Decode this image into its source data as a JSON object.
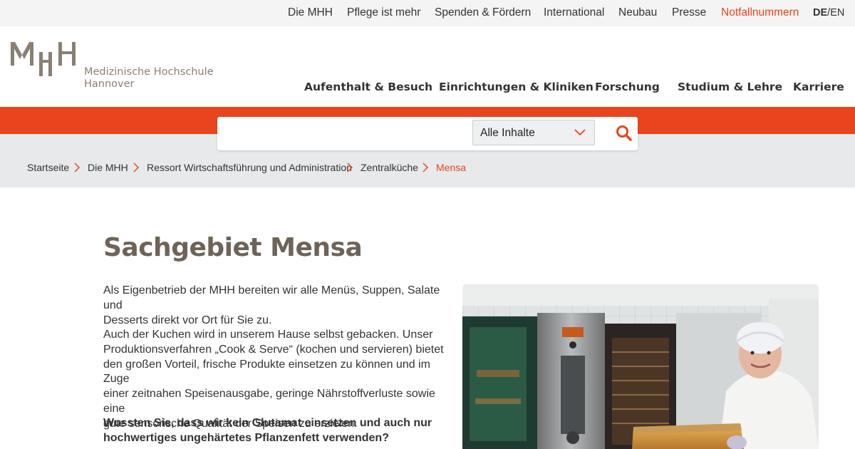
{
  "topbar": {
    "links": [
      "Die MHH",
      "Pflege ist mehr",
      "Spenden & Fördern",
      "International",
      "Neubau",
      "Presse",
      "Notfallnummern"
    ],
    "lang_de": "DE",
    "lang_sep": "/",
    "lang_en": "EN",
    "accent_color": "#e8451e"
  },
  "logo": {
    "line1": "Medizinische Hochschule",
    "line2": "Hannover"
  },
  "mainnav": [
    "Aufenthalt & Besuch",
    "Einrichtungen & Kliniken",
    "Forschung",
    "Studium & Lehre",
    "Karriere"
  ],
  "search": {
    "value": "",
    "filter": "Alle Inhalte"
  },
  "breadcrumb": [
    "Startseite",
    "Die MHH",
    "Ressort Wirtschaftsführung und Administration",
    "Zentralküche",
    "Mensa"
  ],
  "content": {
    "title": "Sachgebiet Mensa",
    "p1_l1": "Als Eigenbetrieb der MHH bereiten wir alle Menüs, Suppen, Salate und",
    "p1_l2": "Desserts direkt vor Ort für Sie zu.",
    "p2_l1": "Auch der Kuchen wird in unserem Hause selbst gebacken. Unser",
    "p2_l2": "Produktionsverfahren „Cook & Serve“ (kochen und servieren) bietet",
    "p2_l3": "den großen Vorteil, frische Produkte einsetzen zu können und im Zuge",
    "p2_l4": "einer zeitnahen Speisenausgabe, geringe Nährstoffverluste sowie eine",
    "p2_l5": "gute sensorische Qualität der Speisen zu erzielen.",
    "p3_l1": "Wussten Sie, dass wir kein Glutamat einsetzen und auch nur",
    "p3_l2": "hochwertiges ungehärtetes Pflanzenfett verwenden?"
  },
  "icons": [
    "search-icon",
    "chevron-down-icon",
    "chevron-right-icon"
  ]
}
